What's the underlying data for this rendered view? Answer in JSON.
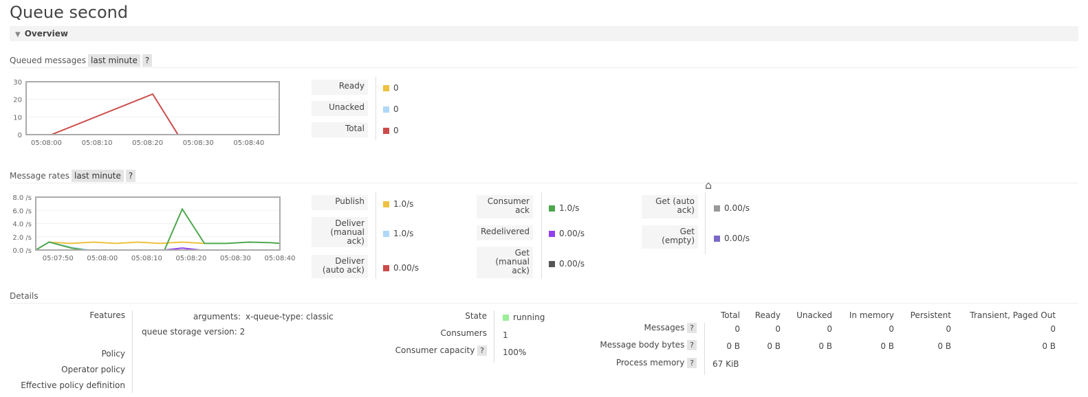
{
  "title": "Queue second",
  "overview_label": "Overview",
  "queued": {
    "label": "Queued messages",
    "range": "last minute",
    "help": "?",
    "legend": [
      {
        "label": "Ready",
        "value": "0",
        "color": "#edc240"
      },
      {
        "label": "Unacked",
        "value": "0",
        "color": "#afd8f8"
      },
      {
        "label": "Total",
        "value": "0",
        "color": "#cb4b4b"
      }
    ]
  },
  "rates": {
    "label": "Message rates",
    "range": "last minute",
    "help": "?",
    "legend": [
      {
        "label": "Publish",
        "value": "1.0/s",
        "color": "#edc240"
      },
      {
        "label": "Deliver (manual ack)",
        "value": "1.0/s",
        "color": "#afd8f8"
      },
      {
        "label": "Deliver (auto ack)",
        "value": "0.00/s",
        "color": "#cb4b4b"
      },
      {
        "label": "Consumer ack",
        "value": "1.0/s",
        "color": "#4da74d"
      },
      {
        "label": "Redelivered",
        "value": "0.00/s",
        "color": "#9440ed"
      },
      {
        "label": "Get (manual ack)",
        "value": "0.00/s",
        "color": "#555555"
      },
      {
        "label": "Get (auto ack)",
        "value": "0.00/s",
        "color": "#999999"
      },
      {
        "label": "Get (empty)",
        "value": "0.00/s",
        "color": "#7c68c7"
      }
    ]
  },
  "chart_data": [
    {
      "type": "line",
      "xlim": [
        "05:07:56",
        "05:08:46"
      ],
      "ylim": [
        0,
        30
      ],
      "yticks": [
        "0",
        "10",
        "20",
        "30"
      ],
      "xticks": [
        "05:08:00",
        "05:08:10",
        "05:08:20",
        "05:08:30",
        "05:08:40"
      ],
      "grid": true,
      "series": [
        {
          "name": "Total",
          "color": "#cb4b4b",
          "points": [
            [
              "05:07:56",
              0
            ],
            [
              "05:08:01",
              0
            ],
            [
              "05:08:21",
              23
            ],
            [
              "05:08:26",
              0
            ],
            [
              "05:08:46",
              0
            ]
          ]
        },
        {
          "name": "Unacked",
          "color": "#afd8f8",
          "points": [
            [
              "05:08:01",
              0
            ],
            [
              "05:08:26",
              0
            ]
          ]
        }
      ]
    },
    {
      "type": "line",
      "xlim": [
        "05:07:45",
        "05:08:40"
      ],
      "ylim": [
        0,
        8
      ],
      "yticks": [
        "0.0 /s",
        "2.0 /s",
        "4.0 /s",
        "6.0 /s",
        "8.0 /s"
      ],
      "xticks": [
        "05:07:50",
        "05:08:00",
        "05:08:10",
        "05:08:20",
        "05:08:30",
        "05:08:40"
      ],
      "grid": true,
      "series": [
        {
          "name": "Publish",
          "color": "#edc240",
          "points": [
            [
              "05:07:48",
              1.2
            ],
            [
              "05:07:53",
              1.0
            ],
            [
              "05:07:58",
              1.2
            ],
            [
              "05:08:03",
              1.0
            ],
            [
              "05:08:08",
              1.2
            ],
            [
              "05:08:13",
              1.0
            ],
            [
              "05:08:18",
              1.2
            ],
            [
              "05:08:23",
              1.0
            ]
          ]
        },
        {
          "name": "Deliver (manual ack)",
          "color": "#afd8f8",
          "points": [
            [
              "05:07:45",
              0
            ],
            [
              "05:07:48",
              1.2
            ],
            [
              "05:07:53",
              0.4
            ],
            [
              "05:07:57",
              0
            ]
          ]
        },
        {
          "name": "Redelivered",
          "color": "#9440ed",
          "points": [
            [
              "05:08:14",
              0
            ],
            [
              "05:08:18",
              0.3
            ],
            [
              "05:08:22",
              0
            ]
          ]
        },
        {
          "name": "Consumer ack",
          "color": "#4da74d",
          "points": [
            [
              "05:07:45",
              0
            ],
            [
              "05:07:48",
              1.2
            ],
            [
              "05:07:53",
              0.3
            ],
            [
              "05:07:56",
              0
            ],
            [
              "05:08:14",
              0
            ],
            [
              "05:08:18",
              6.2
            ],
            [
              "05:08:23",
              1.0
            ],
            [
              "05:08:28",
              1.0
            ],
            [
              "05:08:33",
              1.2
            ],
            [
              "05:08:38",
              1.1
            ],
            [
              "05:08:40",
              1.0
            ]
          ]
        }
      ]
    }
  ],
  "details": {
    "label": "Details",
    "left": {
      "features": "Features",
      "arguments_label": "arguments:",
      "arg_key": "x-queue-type:",
      "arg_value": "classic",
      "storage_label": "queue storage version:",
      "storage_value": "2",
      "policy": "Policy",
      "operator_policy": "Operator policy",
      "effective_policy": "Effective policy definition"
    },
    "mid": {
      "state_label": "State",
      "state_value": "running",
      "state_color": "#99ee99",
      "consumers_label": "Consumers",
      "consumers_value": "1",
      "capacity_label": "Consumer capacity",
      "capacity_value": "100%",
      "help": "?"
    },
    "stats": {
      "columns": [
        "Total",
        "Ready",
        "Unacked",
        "In memory",
        "Persistent",
        "Transient, Paged Out"
      ],
      "rows": [
        {
          "label": "Messages",
          "values": [
            "0",
            "0",
            "0",
            "0",
            "0",
            "0"
          ]
        },
        {
          "label": "Message body bytes",
          "values": [
            "0 B",
            "0 B",
            "0 B",
            "0 B",
            "0 B",
            "0 B"
          ]
        },
        {
          "label": "Process memory",
          "values": [
            "67 KiB"
          ]
        }
      ]
    }
  }
}
